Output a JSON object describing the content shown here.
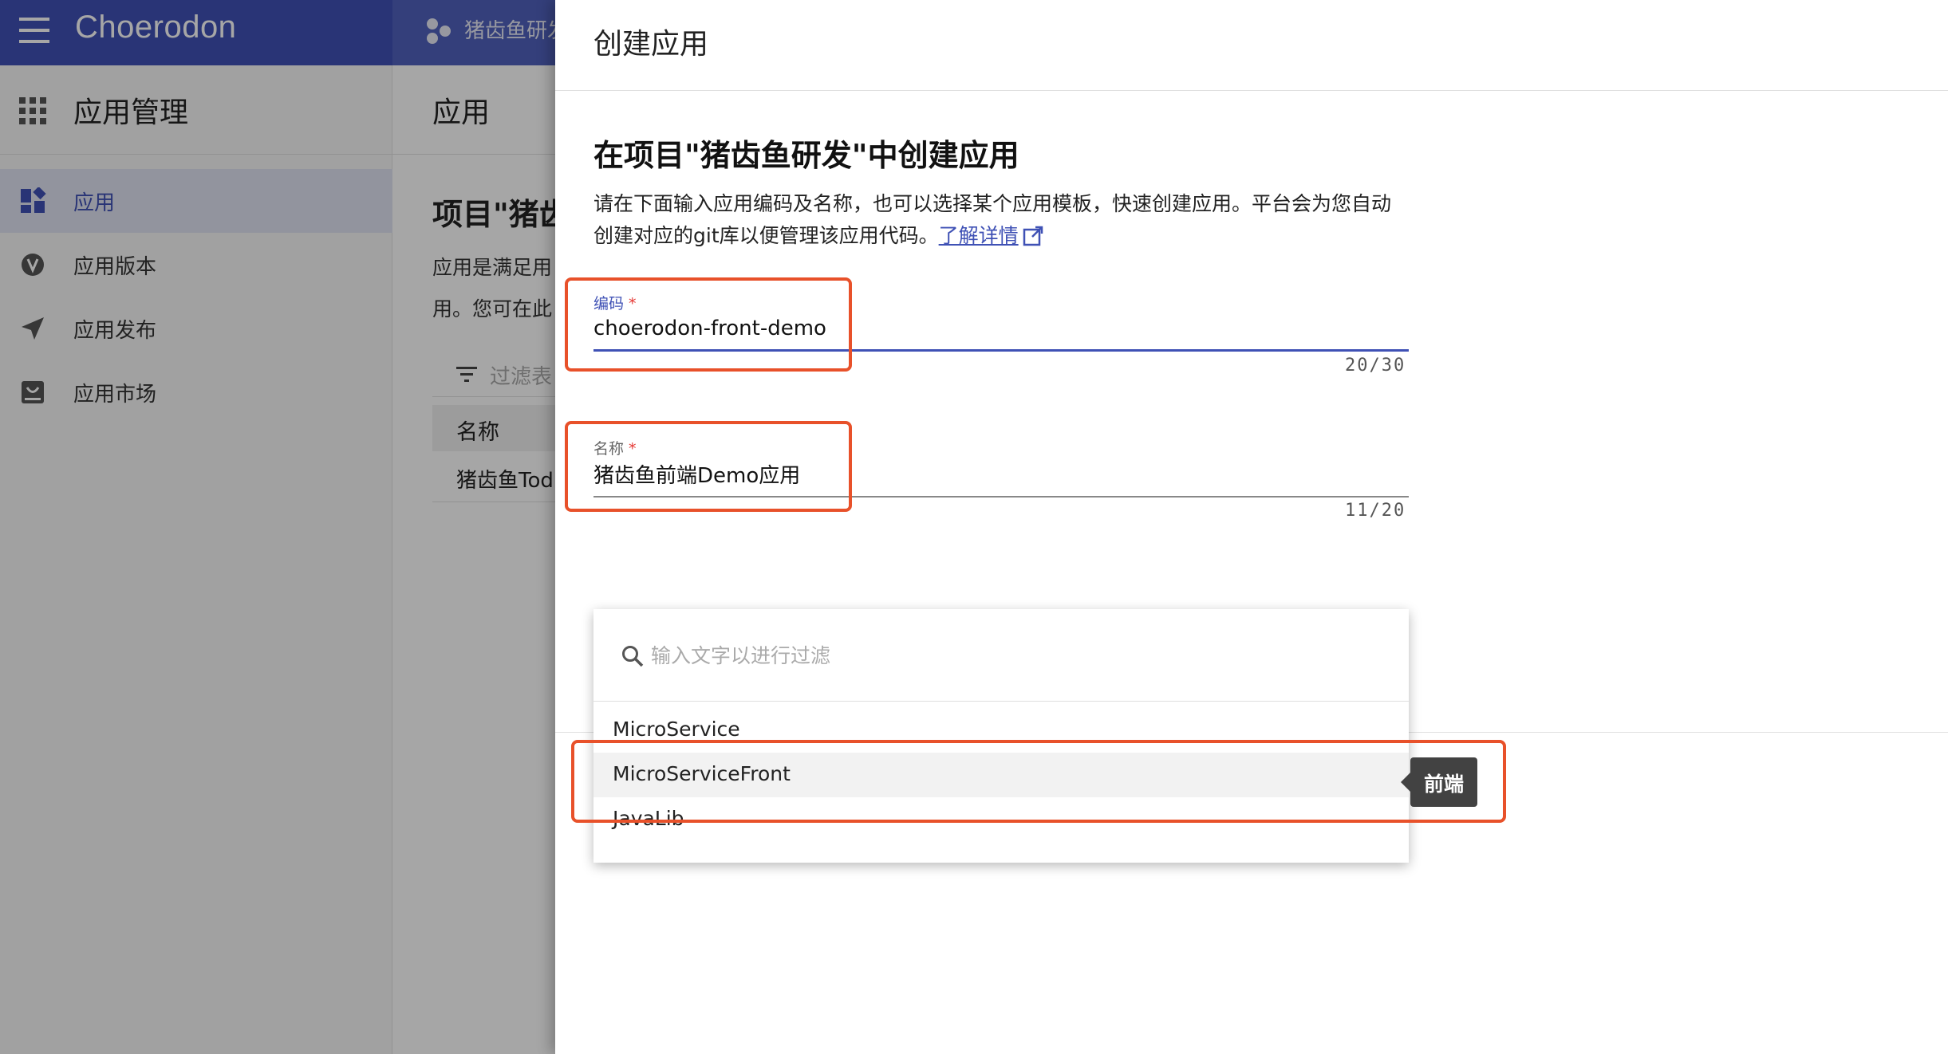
{
  "topbar": {
    "brand": "Choerodon",
    "project_name": "猪齿鱼研发"
  },
  "sidebar": {
    "title": "应用管理",
    "items": [
      {
        "label": "应用",
        "icon": "dashboard-icon",
        "active": true
      },
      {
        "label": "应用版本",
        "icon": "version-icon",
        "active": false
      },
      {
        "label": "应用发布",
        "icon": "send-icon",
        "active": false
      },
      {
        "label": "应用市场",
        "icon": "store-icon",
        "active": false
      }
    ]
  },
  "content": {
    "title": "应用",
    "heading": "项目\"猪齿",
    "desc_line1": "应用是满足用",
    "desc_line2": "用。您可在此",
    "filter_placeholder": "过滤表",
    "table_header": "名称",
    "table_row": "猪齿鱼Tod"
  },
  "drawer": {
    "title": "创建应用",
    "heading": "在项目\"猪齿鱼研发\"中创建应用",
    "description": "请在下面输入应用编码及名称，也可以选择某个应用模板，快速创建应用。平台会为您自动创建对应的git库以便管理该应用代码。",
    "learn_more": "了解详情",
    "code_field": {
      "label": "编码",
      "required_mark": "*",
      "value": "choerodon-front-demo",
      "counter": "20/30"
    },
    "name_field": {
      "label": "名称",
      "required_mark": "*",
      "value": "猪齿鱼前端Demo应用",
      "counter": "11/20"
    },
    "template_dropdown": {
      "search_placeholder": "输入文字以进行过滤",
      "options": [
        "MicroService",
        "MicroServiceFront",
        "JavaLib"
      ],
      "hovered_option": "MicroServiceFront",
      "tooltip": "前端"
    }
  },
  "colors": {
    "primary": "#3f51b5",
    "highlight": "#e8512a",
    "required": "#e53935",
    "tooltip_bg": "#424242"
  }
}
